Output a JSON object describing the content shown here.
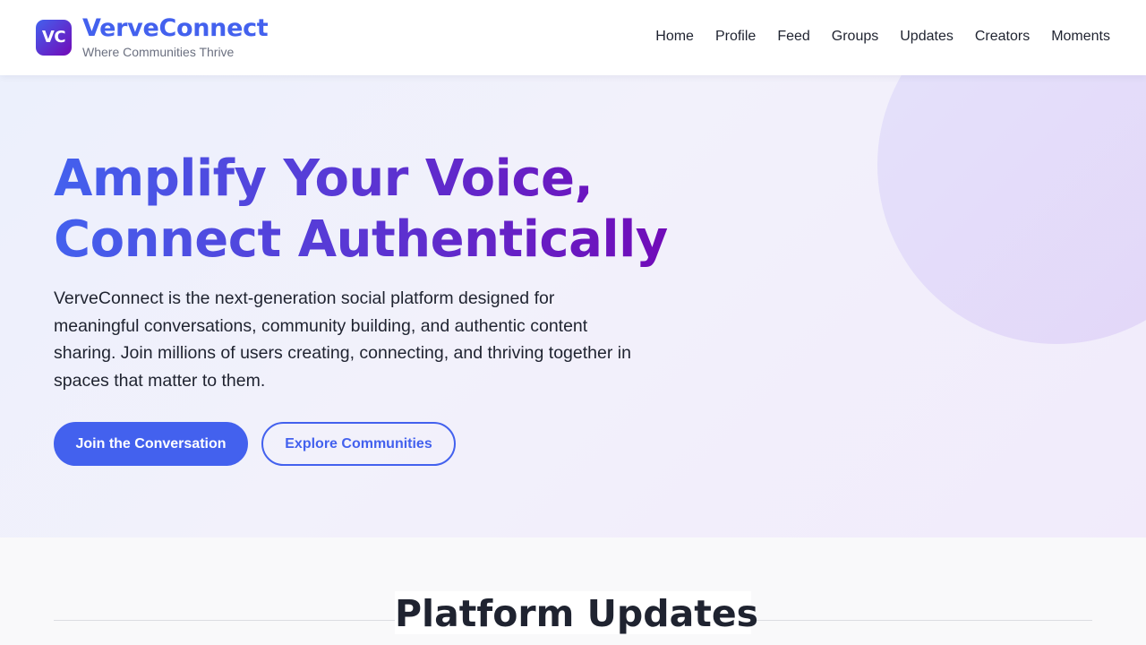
{
  "header": {
    "logo_text": "VC",
    "brand_name": "VerveConnect",
    "tagline": "Where Communities Thrive",
    "nav": [
      {
        "label": "Home"
      },
      {
        "label": "Profile"
      },
      {
        "label": "Feed"
      },
      {
        "label": "Groups"
      },
      {
        "label": "Updates"
      },
      {
        "label": "Creators"
      },
      {
        "label": "Moments"
      }
    ]
  },
  "hero": {
    "title_line1": "Amplify Your Voice,",
    "title_line2": "Connect Authentically",
    "description": "VerveConnect is the next-generation social platform designed for meaningful conversations, community building, and authentic content sharing. Join millions of users creating, connecting, and thriving together in spaces that matter to them.",
    "primary_button": "Join the Conversation",
    "secondary_button": "Explore Communities"
  },
  "updates": {
    "title": "Platform Updates"
  },
  "colors": {
    "accent": "#4361ee",
    "accent_purple": "#7209b7",
    "text": "#1f2330",
    "muted": "#6b7080"
  }
}
